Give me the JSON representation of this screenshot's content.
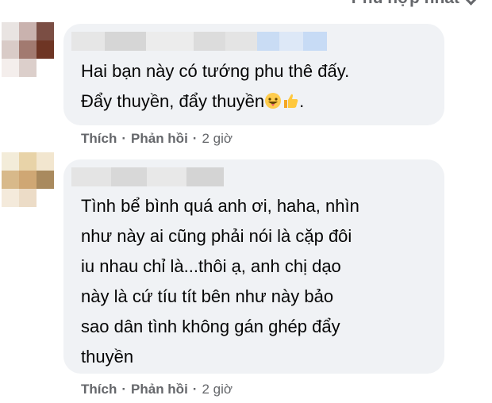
{
  "sort": {
    "label": "Phù hợp nhất"
  },
  "comments": [
    {
      "text": "Hai bạn này có tướng phu thê đấy.\nĐẩy thuyền, đẩy thuyền",
      "text_suffix": ".",
      "emojis": [
        "grinning-tongue-emoji",
        "thumbs-up-emoji"
      ],
      "like": "Thích",
      "reply": "Phản hồi",
      "sep": "·",
      "time": "2 giờ"
    },
    {
      "text": "Tình bể bình quá anh ơi, haha, nhìn\nnhư này ai cũng phải nói là cặp đôi\niu nhau chỉ là...thôi ạ, anh chị dạo\nnày là cứ tíu tít bên như này bảo\nsao dân tình không gán ghép đẩy\nthuyền",
      "like": "Thích",
      "reply": "Phản hồi",
      "sep": "·",
      "time": "2 giờ"
    }
  ],
  "colors": {
    "bubble": "#f0f2f5",
    "meta": "#65676b",
    "text": "#050505"
  }
}
